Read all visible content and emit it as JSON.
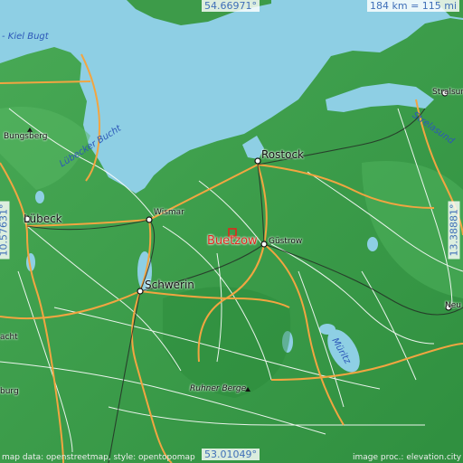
{
  "map": {
    "target": "Buetzow",
    "target_color": "#e0281c",
    "coordinates": {
      "north": "54.66971°",
      "south": "53.01049°",
      "west": "10.57631°",
      "east": "13.38881°"
    },
    "scale": "184 km = 115 mi",
    "places": [
      {
        "name": "Rostock"
      },
      {
        "name": "Lübeck"
      },
      {
        "name": "Wismar"
      },
      {
        "name": "Schwerin"
      },
      {
        "name": "Güstrow"
      },
      {
        "name": "Stralsund"
      },
      {
        "name": "Bungsberg"
      },
      {
        "name": "Ruhner Berge"
      },
      {
        "name": "Neu"
      },
      {
        "name": "acht"
      },
      {
        "name": "burg"
      }
    ],
    "water_labels": [
      {
        "name": "- Kiel Bugt"
      },
      {
        "name": "Lübecker Bucht"
      },
      {
        "name": "Strelasund"
      },
      {
        "name": "Müritz"
      }
    ],
    "credits": {
      "left": "map data: openstreetmap, style: opentopomap",
      "right": "image proc.: elevation.city"
    },
    "colors": {
      "water": "#8ecfe4",
      "land": "#3c9f4a",
      "roads_major": "#f2a541",
      "roads_minor": "#ffffff"
    }
  }
}
